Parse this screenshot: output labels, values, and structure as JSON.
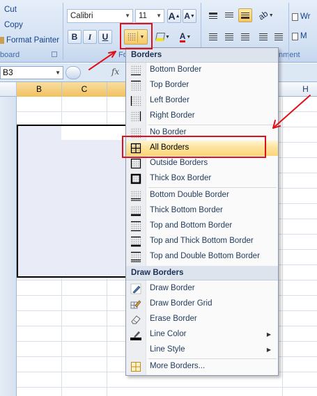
{
  "ribbon": {
    "clipboard": {
      "items": [
        "Cut",
        "Copy",
        "Format Painter"
      ],
      "group_label": "board"
    },
    "font": {
      "family": "Calibri",
      "size": "11",
      "bold": "B",
      "italic": "I",
      "underline": "U",
      "grow": "A",
      "shrink": "A",
      "font_color_letter": "A",
      "group_label": "Fo"
    },
    "alignment": {
      "group_label": "nment"
    },
    "wrap": {
      "label": "Wr",
      "merge": "M"
    }
  },
  "formula_bar": {
    "name_box": "B3",
    "fx": "fx"
  },
  "columns": [
    "B",
    "C",
    "H"
  ],
  "menu": {
    "header_borders": "Borders",
    "borders": [
      {
        "label": "Bottom Border",
        "icon": "bottom-border-icon"
      },
      {
        "label": "Top Border",
        "icon": "top-border-icon"
      },
      {
        "label": "Left Border",
        "icon": "left-border-icon"
      },
      {
        "label": "Right Border",
        "icon": "right-border-icon"
      },
      {
        "label": "No Border",
        "icon": "no-border-icon"
      },
      {
        "label": "All Borders",
        "icon": "all-borders-icon"
      },
      {
        "label": "Outside Borders",
        "icon": "outside-borders-icon"
      },
      {
        "label": "Thick Box Border",
        "icon": "thick-box-border-icon"
      },
      {
        "label": "Bottom Double Border",
        "icon": "bottom-double-border-icon"
      },
      {
        "label": "Thick Bottom Border",
        "icon": "thick-bottom-border-icon"
      },
      {
        "label": "Top and Bottom Border",
        "icon": "top-bottom-border-icon"
      },
      {
        "label": "Top and Thick Bottom Border",
        "icon": "top-thick-bottom-border-icon"
      },
      {
        "label": "Top and Double Bottom Border",
        "icon": "top-double-bottom-border-icon"
      }
    ],
    "header_draw": "Draw Borders",
    "draw": [
      {
        "label": "Draw Border",
        "icon": "pencil-icon"
      },
      {
        "label": "Draw Border Grid",
        "icon": "pencil-grid-icon"
      },
      {
        "label": "Erase Border",
        "icon": "eraser-icon"
      },
      {
        "label": "Line Color",
        "icon": "line-color-icon"
      },
      {
        "label": "Line Style",
        "icon": "line-style-icon"
      },
      {
        "label": "More Borders...",
        "icon": "more-borders-icon"
      }
    ],
    "highlighted_item": "All Borders"
  },
  "colors": {
    "accent_red": "#e0101a",
    "hover_gold": "#fbd678",
    "ribbon_blue": "#d3e1f3"
  }
}
